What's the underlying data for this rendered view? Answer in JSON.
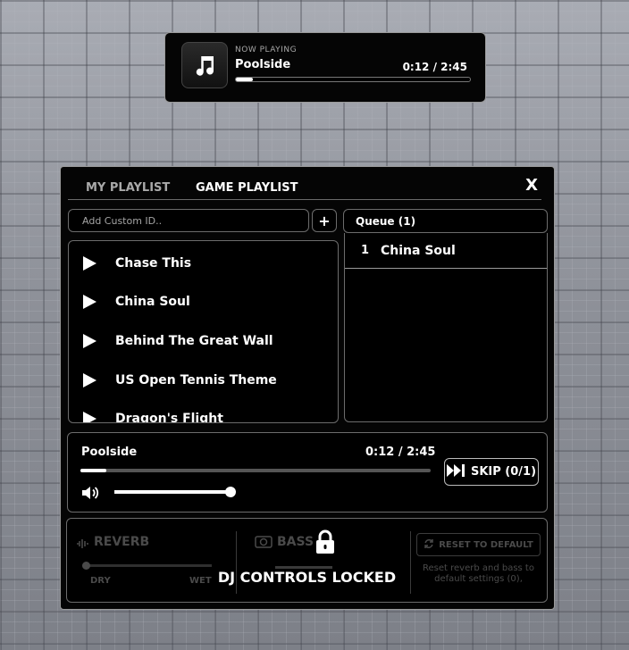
{
  "now_playing": {
    "label": "NOW PLAYING",
    "title": "Poolside",
    "time": "0:12 / 2:45",
    "progress": 0.073
  },
  "tabs": [
    {
      "label": "MY PLAYLIST",
      "active": false
    },
    {
      "label": "GAME PLAYLIST",
      "active": true
    }
  ],
  "close_label": "X",
  "custom_id": {
    "placeholder": "Add Custom ID..",
    "value": ""
  },
  "add_label": "+",
  "songs": [
    "Chase This",
    "China Soul",
    "Behind The Great Wall",
    "US Open Tennis Theme",
    "Dragon's Flight"
  ],
  "queue": {
    "title": "Queue (1)",
    "items": [
      {
        "num": "1",
        "name": "China Soul"
      }
    ]
  },
  "player": {
    "title": "Poolside",
    "time": "0:12 / 2:45",
    "progress": 0.073,
    "volume": 1.0,
    "skip_label": "SKIP (0/1)"
  },
  "dj": {
    "reverb_label": "REVERB",
    "dry_label": "DRY",
    "wet_label": "WET",
    "reverb_value": 0.0,
    "bass_label": "BASS",
    "reset_label": "RESET TO DEFAULT",
    "reset_note": "Reset reverb and bass to default settings (0),",
    "locked_label": "DJ CONTROLS LOCKED"
  },
  "colors": {
    "panel_bg": "#050505",
    "border": "#6c6c6c",
    "text": "#ffffff",
    "muted": "#a9a9a9",
    "disabled": "#4a4a4a"
  }
}
